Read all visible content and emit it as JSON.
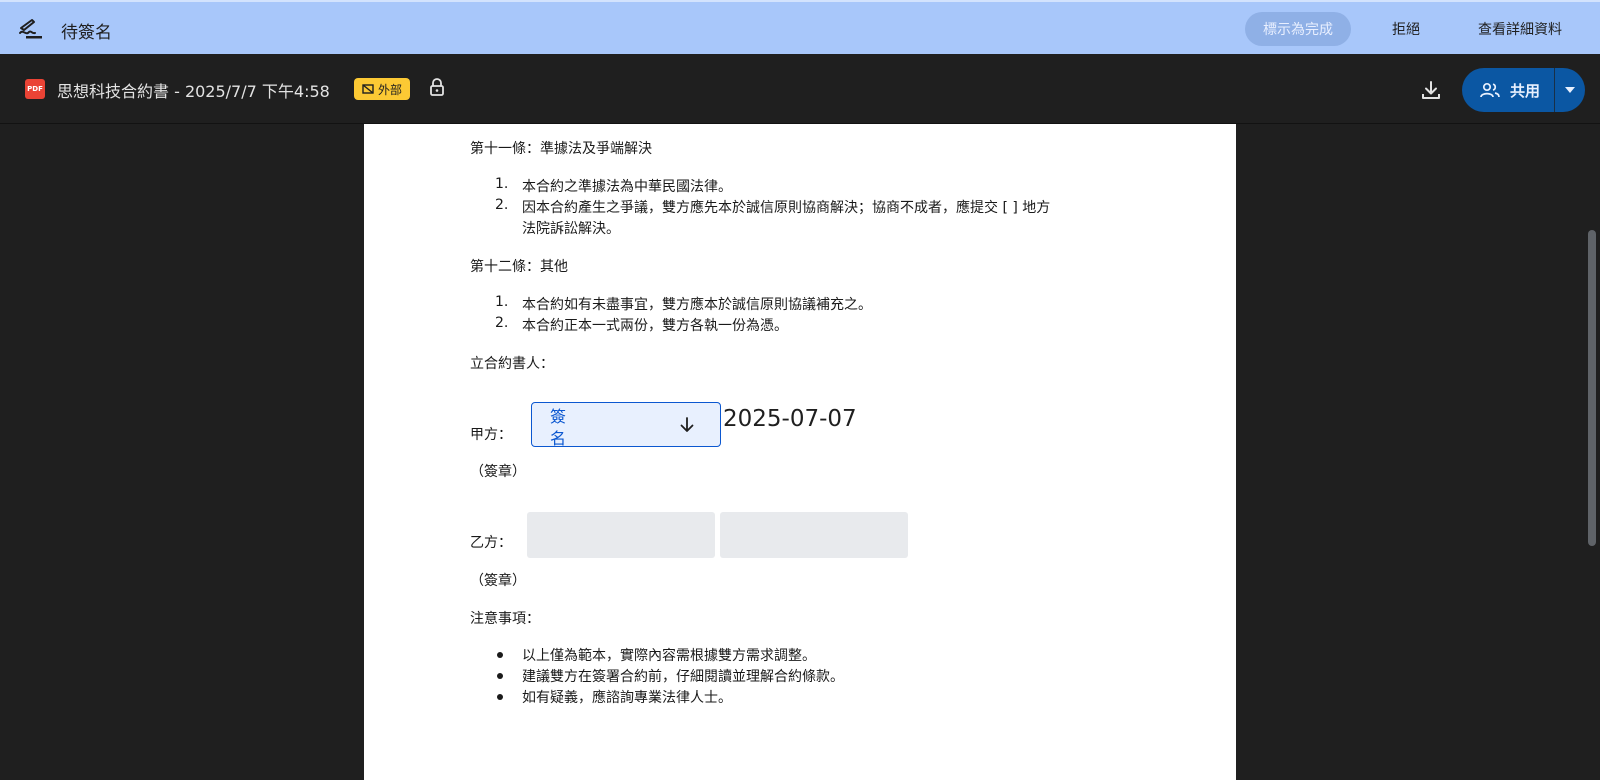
{
  "sign_bar": {
    "title": "待簽名",
    "done_label": "標示為完成",
    "reject_label": "拒絕",
    "details_label": "查看詳細資料"
  },
  "file_bar": {
    "file_icon_text": "PDF",
    "file_title": "思想科技合約書 - 2025/7/7 下午4:58",
    "external_badge": "外部",
    "share_label": "共用"
  },
  "document": {
    "article11_heading": "第十一條：準據法及爭端解決",
    "article11_items": [
      {
        "num": "1.",
        "lines": [
          "本合約之準據法為中華民國法律。"
        ]
      },
      {
        "num": "2.",
        "lines": [
          "因本合約產生之爭議，雙方應先本於誠信原則協商解決；協商不成者，應提交 [ ] 地方",
          "法院訴訟解決。"
        ]
      }
    ],
    "article12_heading": "第十二條：其他",
    "article12_items": [
      {
        "num": "1.",
        "lines": [
          "本合約如有未盡事宜，雙方應本於誠信原則協議補充之。"
        ]
      },
      {
        "num": "2.",
        "lines": [
          "本合約正本一式兩份，雙方各執一份為憑。"
        ]
      }
    ],
    "signatories_heading": "立合約書人：",
    "party_a_label": "甲方：",
    "signature_field_label": "簽名",
    "signature_date": "2025-07-07",
    "seal_label_a": "（簽章）",
    "party_b_label": "乙方：",
    "seal_label_b": "（簽章）",
    "notes_heading": "注意事項：",
    "notes": [
      "以上僅為範本，實際內容需根據雙方需求調整。",
      "建議雙方在簽署合約前，仔細閱讀並理解合約條款。",
      "如有疑義，應諮詢專業法律人士。"
    ]
  },
  "icons": {
    "sign": "signature-pen-icon",
    "pdf": "pdf-file-icon",
    "external": "external-domain-icon",
    "lock": "lock-icon",
    "download": "download-icon",
    "share": "people-icon",
    "caret": "caret-down-icon",
    "arrow": "arrow-down-icon"
  },
  "colors": {
    "sign_bar_bg": "#a8c7fa",
    "app_bg": "#1f1f1f",
    "share_button": "#0b57a3",
    "external_badge": "#fcc934",
    "signature_field_border": "#0b57d0"
  }
}
